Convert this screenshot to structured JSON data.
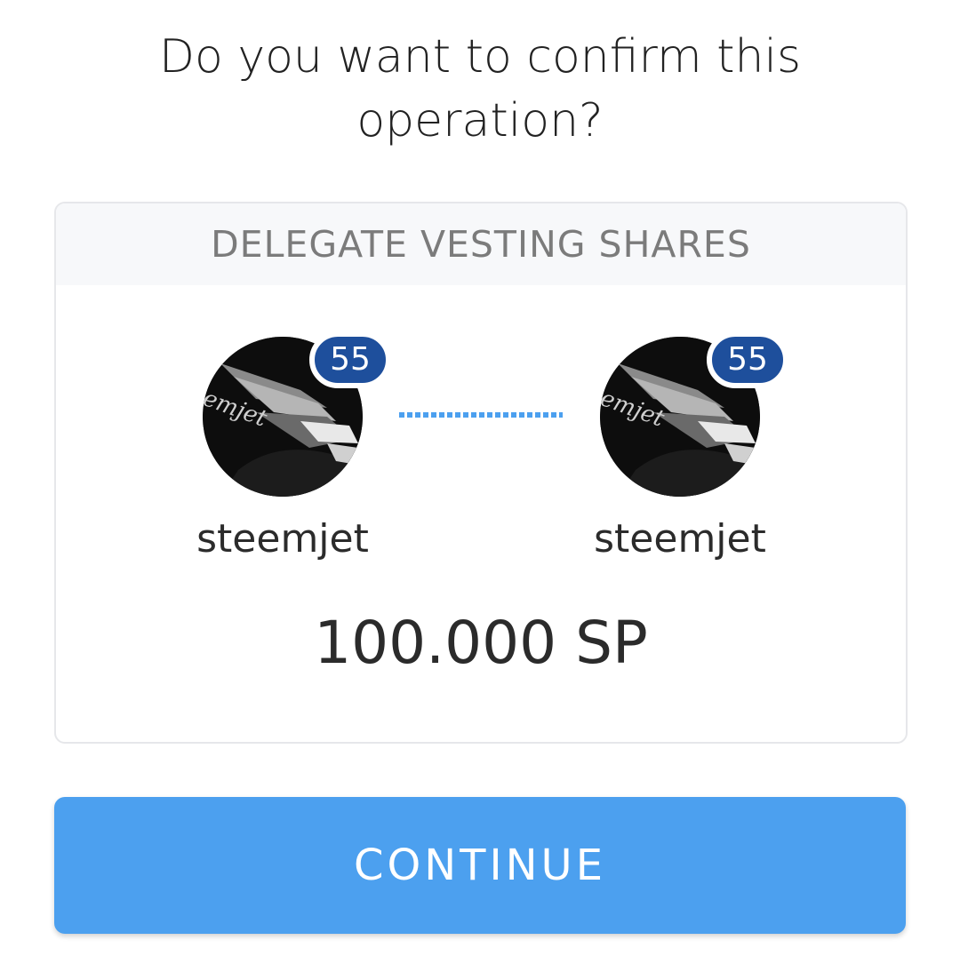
{
  "dialog": {
    "question": "Do you want to confirm this operation?"
  },
  "operation": {
    "title": "DELEGATE VESTING SHARES",
    "from": {
      "username": "steemjet",
      "reputation": "55",
      "avatar_icon": "steemjet-avatar"
    },
    "to": {
      "username": "steemjet",
      "reputation": "55",
      "avatar_icon": "steemjet-avatar"
    },
    "amount": "100.000 SP"
  },
  "actions": {
    "continue_label": "CONTINUE"
  },
  "colors": {
    "button": "#4ca0ef",
    "badge": "#1e4f9c",
    "connector": "#4ca0ef"
  }
}
